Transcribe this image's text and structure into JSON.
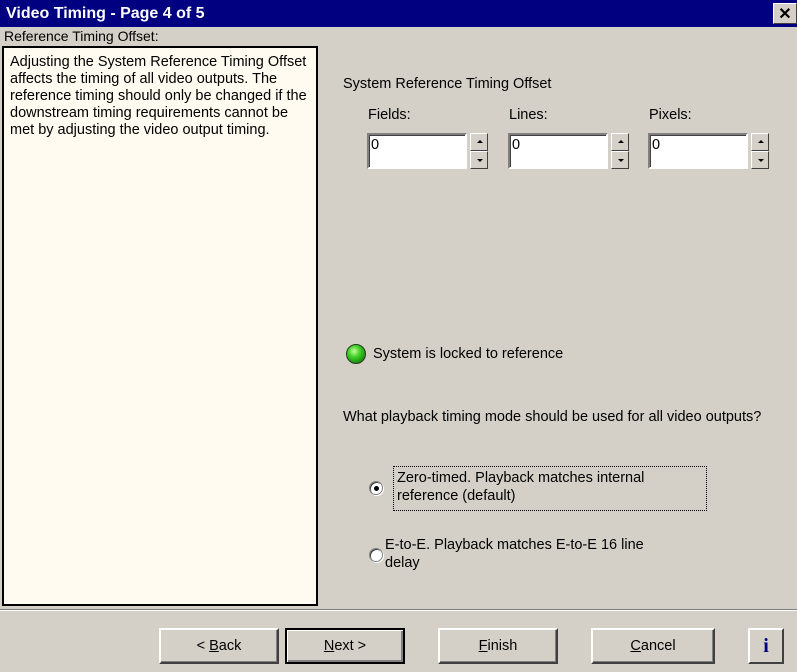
{
  "window": {
    "title": "Video Timing - Page 4 of 5",
    "close_glyph": "✕"
  },
  "section_caption": "Reference Timing Offset:",
  "help_text": "Adjusting the System Reference Timing Offset affects the timing of all video outputs.  The reference timing should only be changed if the downstream timing requirements cannot be met by adjusting the video output timing.",
  "offset": {
    "heading": "System Reference Timing Offset",
    "fields": [
      {
        "label": "Fields:",
        "value": "0"
      },
      {
        "label": "Lines:",
        "value": "0"
      },
      {
        "label": "Pixels:",
        "value": "0"
      }
    ]
  },
  "status": {
    "text": "System is locked to reference",
    "led_color": "#41d32a"
  },
  "playback": {
    "question": "What playback timing mode should be used for all video outputs?",
    "options": [
      {
        "line1": "Zero-timed. Playback matches internal",
        "line2": "reference (default)",
        "selected": true
      },
      {
        "line1": "E-to-E. Playback matches E-to-E 16 line",
        "line2": "delay",
        "selected": false
      }
    ]
  },
  "buttons": {
    "back_prefix": "< ",
    "back_mnemonic": "B",
    "back_rest": "ack",
    "next_mnemonic": "N",
    "next_rest": "ext >",
    "finish_mnemonic": "F",
    "finish_rest": "inish",
    "cancel_mnemonic": "C",
    "cancel_rest": "ancel",
    "info": "i"
  }
}
